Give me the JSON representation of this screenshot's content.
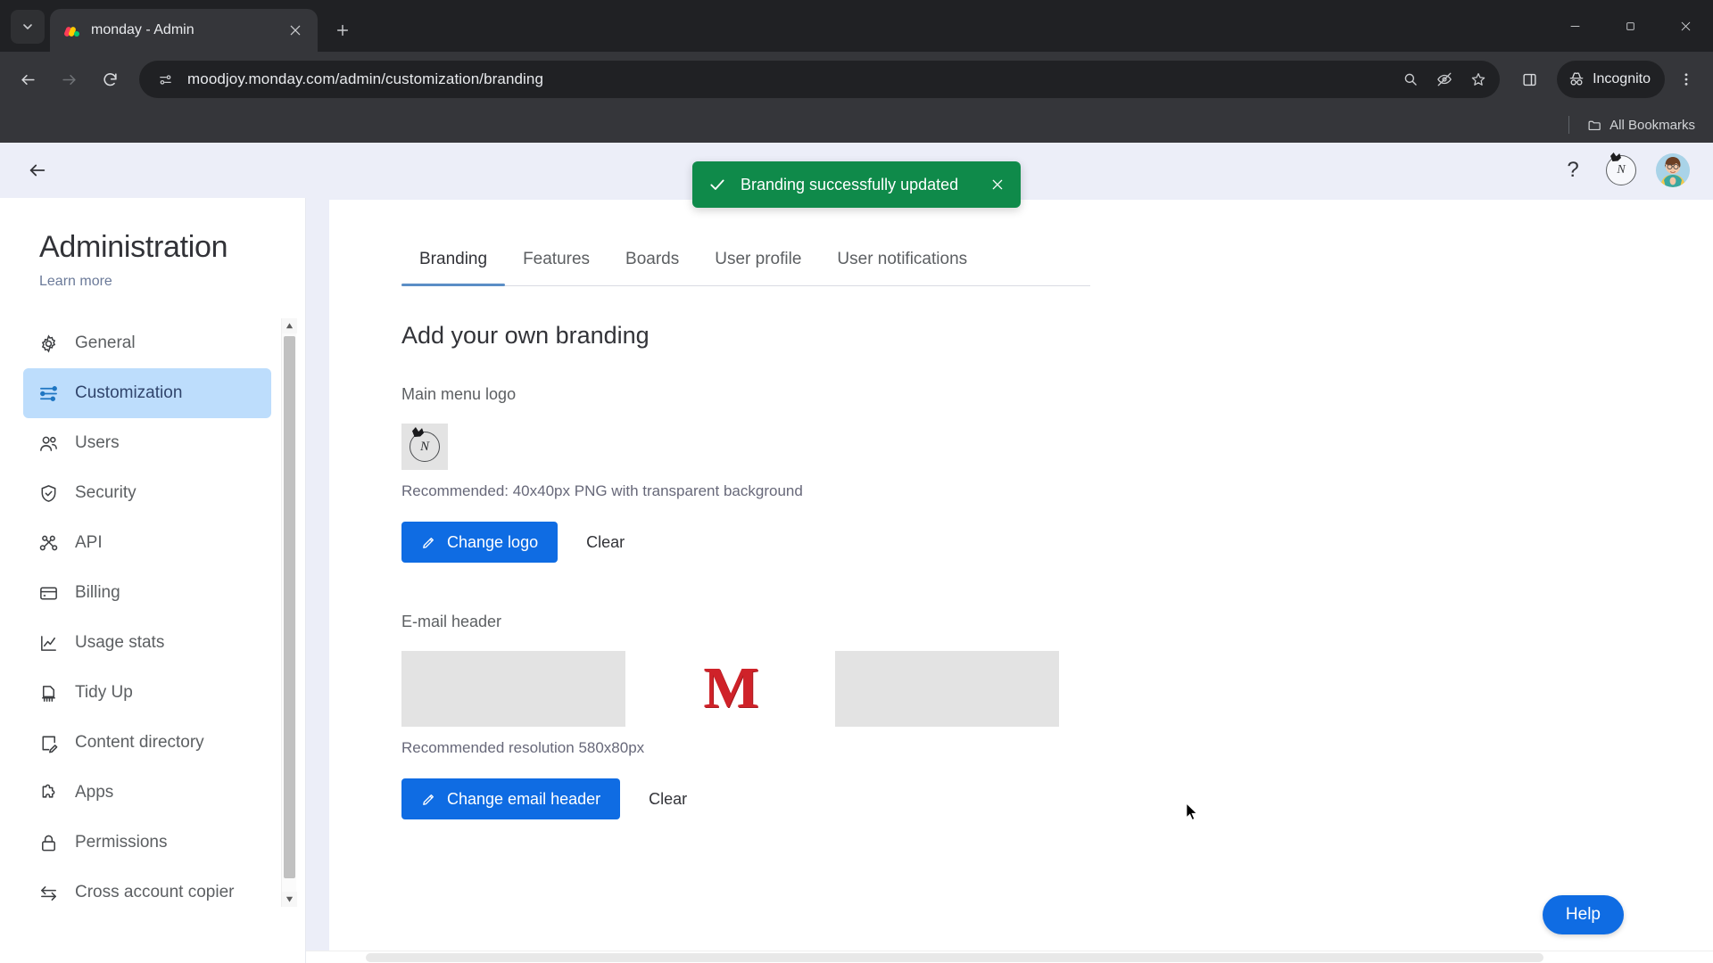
{
  "browser": {
    "tab": {
      "title": "monday - Admin",
      "favicon": "monday-logo-icon"
    },
    "new_tab_label": "+",
    "url": "moodjoy.monday.com/admin/customization/branding",
    "profile_label": "Incognito",
    "bookmarks_label": "All Bookmarks",
    "window_controls": {
      "minimize": "minimize-icon",
      "maximize": "maximize-icon",
      "close": "close-icon"
    },
    "toolbar_icons": [
      "back-icon",
      "forward-icon",
      "reload-icon",
      "site-settings-icon",
      "zoom-icon",
      "tracking-protection-icon",
      "bookmark-star-icon",
      "side-panel-icon",
      "more-menu-icon"
    ]
  },
  "app": {
    "topbar": {
      "back": "back-arrow-icon",
      "help_icon": "?",
      "brand_icon": "account-brand-icon",
      "avatar": "user-avatar"
    },
    "sidebar": {
      "title": "Administration",
      "learn_more": "Learn more",
      "items": [
        {
          "label": "General",
          "icon": "gear-icon",
          "active": false
        },
        {
          "label": "Customization",
          "icon": "sliders-icon",
          "active": true
        },
        {
          "label": "Users",
          "icon": "users-icon",
          "active": false
        },
        {
          "label": "Security",
          "icon": "shield-check-icon",
          "active": false
        },
        {
          "label": "API",
          "icon": "api-nodes-icon",
          "active": false
        },
        {
          "label": "Billing",
          "icon": "credit-card-icon",
          "active": false
        },
        {
          "label": "Usage stats",
          "icon": "chart-line-icon",
          "active": false
        },
        {
          "label": "Tidy Up",
          "icon": "broom-icon",
          "active": false
        },
        {
          "label": "Content directory",
          "icon": "document-edit-icon",
          "active": false
        },
        {
          "label": "Apps",
          "icon": "puzzle-icon",
          "active": false
        },
        {
          "label": "Permissions",
          "icon": "lock-icon",
          "active": false
        },
        {
          "label": "Cross account copier",
          "icon": "transfer-arrows-icon",
          "active": false
        }
      ]
    },
    "tabs": [
      {
        "label": "Branding",
        "active": true
      },
      {
        "label": "Features",
        "active": false
      },
      {
        "label": "Boards",
        "active": false
      },
      {
        "label": "User profile",
        "active": false
      },
      {
        "label": "User notifications",
        "active": false
      }
    ],
    "main": {
      "heading": "Add your own branding",
      "logo_section": {
        "label": "Main menu logo",
        "hint": "Recommended: 40x40px PNG with transparent background",
        "primary_button": "Change logo",
        "clear_button": "Clear"
      },
      "email_section": {
        "label": "E-mail header",
        "preview_letter": "M",
        "hint": "Recommended resolution 580x80px",
        "primary_button": "Change email header",
        "clear_button": "Clear"
      }
    },
    "toast": {
      "message": "Branding successfully updated",
      "icon": "check-icon",
      "close": "close-icon",
      "color": "#0f8a4a"
    },
    "help_fab": "Help",
    "colors": {
      "accent": "#0f6ce3",
      "active_nav": "#bdddfc",
      "app_bg": "#eceef8",
      "success": "#0f8a4a"
    }
  }
}
